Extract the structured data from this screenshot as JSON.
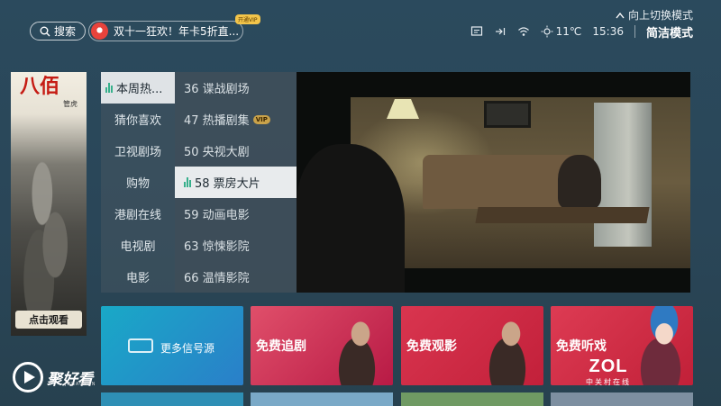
{
  "topbar": {
    "search_label": "搜索",
    "promo_text": "双十一狂欢！年卡5折直...",
    "promo_badge": "开通VIP",
    "switch_mode_label": "向上切换模式",
    "temperature": "11℃",
    "time": "15:36",
    "mode_label": "简洁模式"
  },
  "poster": {
    "title": "八佰",
    "subtitle": "管虎",
    "cta_label": "点击观看"
  },
  "categories": [
    {
      "label": "本周热..."
    },
    {
      "label": "猜你喜欢"
    },
    {
      "label": "卫视剧场"
    },
    {
      "label": "购物"
    },
    {
      "label": "港剧在线"
    },
    {
      "label": "电视剧"
    },
    {
      "label": "电影"
    }
  ],
  "channels": [
    {
      "label": "36 谍战剧场",
      "vip": ""
    },
    {
      "label": "47 热播剧集",
      "vip": "VIP"
    },
    {
      "label": "50 央视大剧",
      "vip": ""
    },
    {
      "label": "58 票房大片",
      "vip": ""
    },
    {
      "label": "59 动画电影",
      "vip": ""
    },
    {
      "label": "63 惊悚影院",
      "vip": ""
    },
    {
      "label": "66 温情影院",
      "vip": ""
    }
  ],
  "tiles": [
    {
      "label": "更多信号源",
      "color": "#1ea3c8"
    },
    {
      "label": "免费追剧",
      "color": "#d43a5a"
    },
    {
      "label": "免费观影",
      "color": "#d9354f"
    },
    {
      "label": "免费听戏",
      "color": "#d73450"
    }
  ],
  "app_logo": {
    "text": "聚好看",
    "sub": "JUHAOKAN"
  },
  "watermark": {
    "main": "ZOL",
    "sub": "中关村在线"
  }
}
